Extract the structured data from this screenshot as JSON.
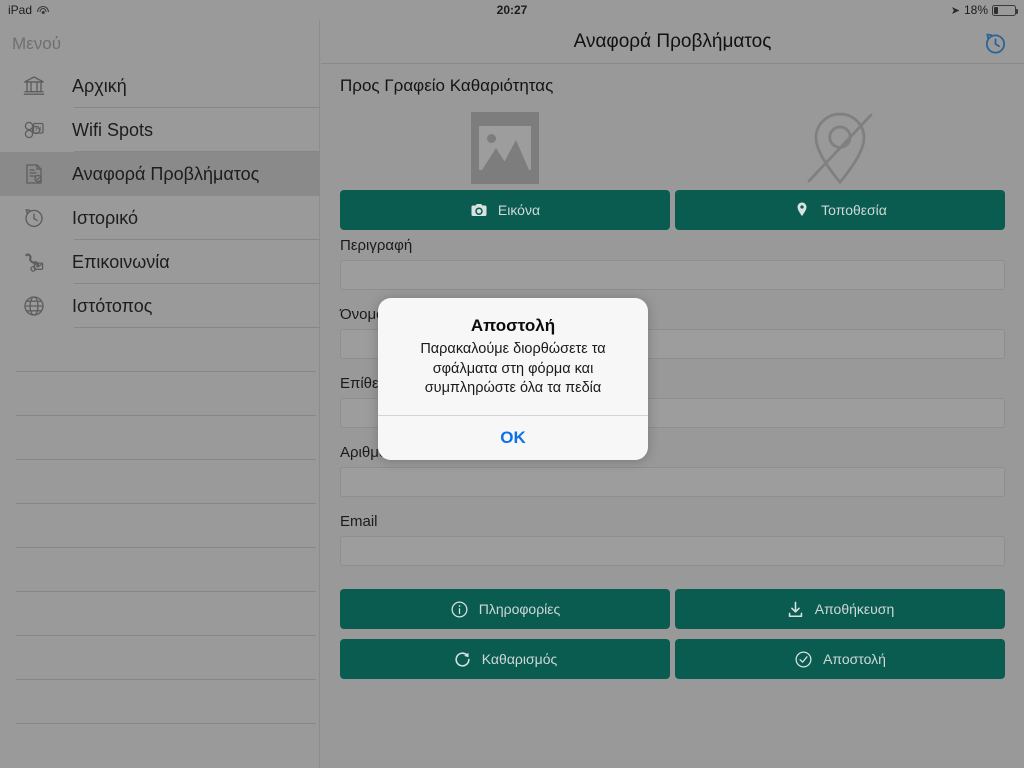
{
  "status_bar": {
    "device": "iPad",
    "wifi_icon": "wifi-icon",
    "time": "20:27",
    "location_icon": "location-arrow-icon",
    "battery_percent": "18%",
    "battery_level": 18
  },
  "sidebar": {
    "title": "Μενού",
    "items": [
      {
        "label": "Αρχική",
        "icon": "bank-icon",
        "selected": false
      },
      {
        "label": "Wifi Spots",
        "icon": "wifi-spot-icon",
        "selected": false
      },
      {
        "label": "Αναφορά Προβλήματος",
        "icon": "report-document-icon",
        "selected": true
      },
      {
        "label": "Ιστορικό",
        "icon": "history-clock-icon",
        "selected": false
      },
      {
        "label": "Επικοινωνία",
        "icon": "contact-phone-icon",
        "selected": false
      },
      {
        "label": "Ιστότοπος",
        "icon": "globe-icon",
        "selected": false
      }
    ],
    "blank_rows": 9
  },
  "navbar": {
    "title": "Αναφορά Προβλήματος",
    "history_icon": "history-restore-icon",
    "history_color": "#2a6496"
  },
  "main": {
    "section_title": "Προς Γραφείο Καθαριότητας",
    "preview": {
      "image_placeholder_icon": "image-placeholder-icon",
      "location_off_icon": "location-off-icon"
    },
    "media_buttons": [
      {
        "label": "Εικόνα",
        "icon": "camera-icon"
      },
      {
        "label": "Τοποθεσία",
        "icon": "map-pin-icon"
      }
    ],
    "fields": [
      {
        "label": "Περιγραφή",
        "value": ""
      },
      {
        "label": "Όνομα",
        "value": ""
      },
      {
        "label": "Επίθετο",
        "value": ""
      },
      {
        "label": "Αριθμός Τηλεφώνου",
        "value": ""
      },
      {
        "label": "Email",
        "value": ""
      }
    ],
    "action_buttons": [
      {
        "label": "Πληροφορίες",
        "icon": "info-icon"
      },
      {
        "label": "Αποθήκευση",
        "icon": "download-save-icon"
      },
      {
        "label": "Καθαρισμός",
        "icon": "refresh-clear-icon"
      },
      {
        "label": "Αποστολή",
        "icon": "check-circle-icon"
      }
    ],
    "accent_color": "#0a5c50"
  },
  "dialog": {
    "title": "Αποστολή",
    "message": "Παρακαλούμε διορθώσετε τα σφάλματα στη φόρμα και συμπληρώστε όλα τα πεδία",
    "ok_label": "OK",
    "ok_color": "#0a72e8"
  }
}
